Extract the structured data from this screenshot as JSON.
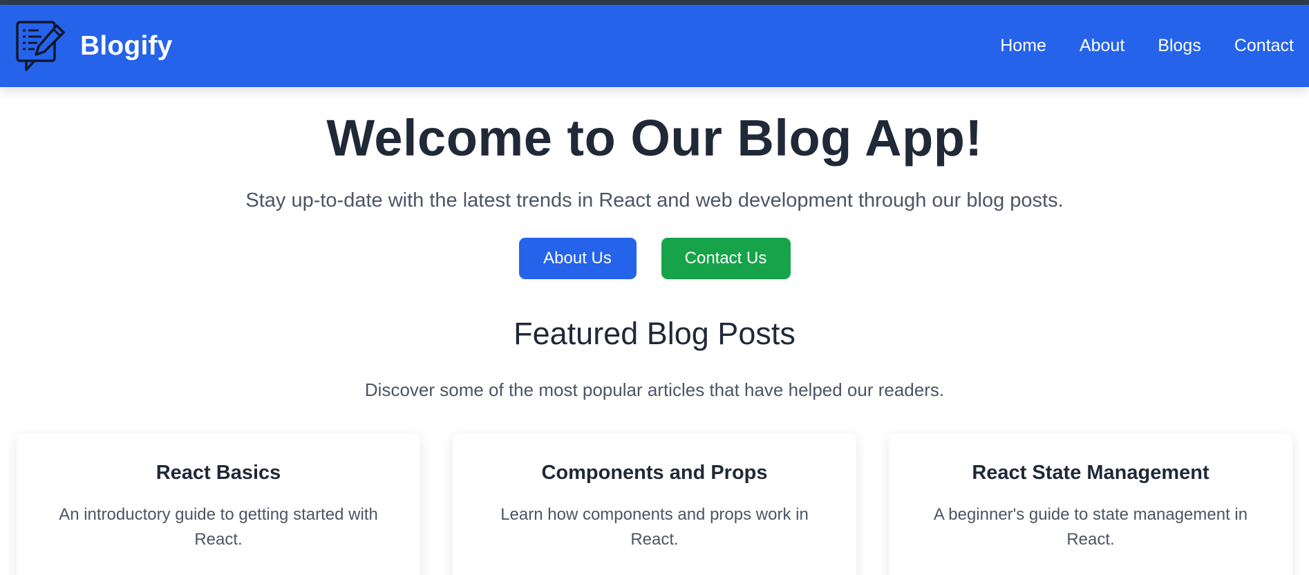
{
  "brand": {
    "name": "Blogify",
    "logo_icon": "note-edit-icon",
    "accent": "#2563eb"
  },
  "nav": {
    "items": [
      {
        "label": "Home"
      },
      {
        "label": "About"
      },
      {
        "label": "Blogs"
      },
      {
        "label": "Contact"
      }
    ]
  },
  "hero": {
    "title": "Welcome to Our Blog App!",
    "subtitle": "Stay up-to-date with the latest trends in React and web development through our blog posts.",
    "buttons": {
      "about": {
        "label": "About Us",
        "color": "#2563eb"
      },
      "contact": {
        "label": "Contact Us",
        "color": "#16a34a"
      }
    }
  },
  "featured": {
    "title": "Featured Blog Posts",
    "subtitle": "Discover some of the most popular articles that have helped our readers.",
    "posts": [
      {
        "title": "React Basics",
        "description": "An introductory guide to getting started with React."
      },
      {
        "title": "Components and Props",
        "description": "Learn how components and props work in React."
      },
      {
        "title": "React State Management",
        "description": "A beginner's guide to state management in React."
      }
    ]
  }
}
